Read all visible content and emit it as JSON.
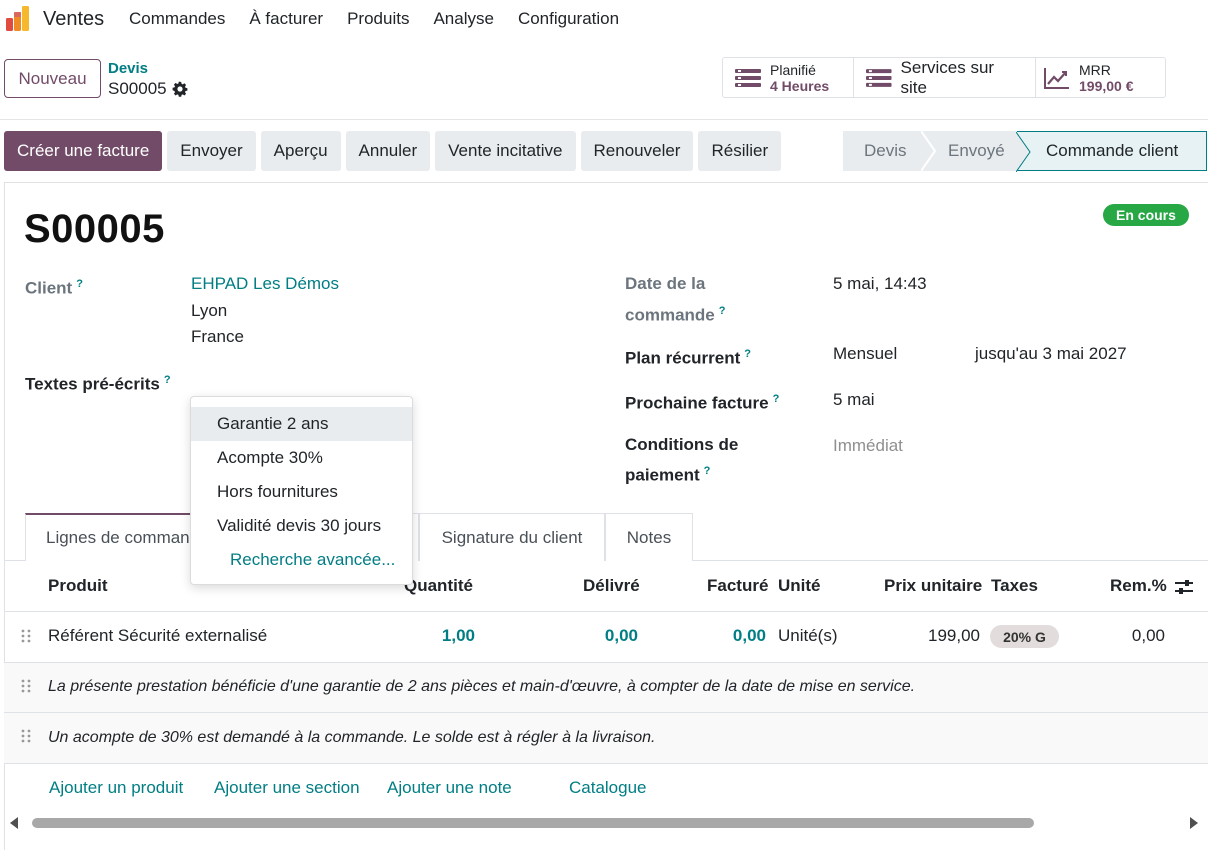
{
  "navbar": {
    "app_name": "Ventes",
    "menu": [
      "Commandes",
      "À facturer",
      "Produits",
      "Analyse",
      "Configuration"
    ]
  },
  "control": {
    "new_label": "Nouveau",
    "breadcrumb_parent": "Devis",
    "breadcrumb_current": "S00005"
  },
  "smart_buttons": {
    "planned_title": "Planifié",
    "planned_value": "4 Heures",
    "onsite_label": "Services sur site",
    "mrr_title": "MRR",
    "mrr_value": "199,00 €"
  },
  "actions": [
    "Créer une facture",
    "Envoyer",
    "Aperçu",
    "Annuler",
    "Vente incitative",
    "Renouveler",
    "Résilier"
  ],
  "statusbar": [
    "Devis",
    "Envoyé",
    "Commande client"
  ],
  "record": {
    "title": "S00005",
    "status_badge": "En cours",
    "client_label": "Client",
    "client_name": "EHPAD Les Démos",
    "client_city": "Lyon",
    "client_country": "France",
    "templates_label": "Textes pré-écrits",
    "order_date_label_1": "Date de la",
    "order_date_label_2": "commande",
    "order_date_value": "5 mai, 14:43",
    "plan_label": "Plan récurrent",
    "plan_value": "Mensuel",
    "plan_until": "jusqu'au 3 mai 2027",
    "next_invoice_label": "Prochaine facture",
    "next_invoice_value": "5 mai",
    "payment_terms_label_1": "Conditions de",
    "payment_terms_label_2": "paiement",
    "payment_terms_placeholder": "Immédiat"
  },
  "dropdown": {
    "items": [
      "Garantie 2 ans",
      "Acompte 30%",
      "Hors fournitures",
      "Validité devis 30 jours"
    ],
    "advanced": "Recherche avancée..."
  },
  "tabs": [
    "Lignes de comman",
    "Signature du client",
    "Notes"
  ],
  "table": {
    "headers": {
      "product": "Produit",
      "quantity": "Quantité",
      "delivered": "Délivré",
      "invoiced": "Facturé",
      "unit": "Unité",
      "unit_price": "Prix unitaire",
      "taxes": "Taxes",
      "discount": "Rem.%"
    },
    "line": {
      "product": "Référent Sécurité externalisé",
      "quantity": "1,00",
      "delivered": "0,00",
      "invoiced": "0,00",
      "unit": "Unité(s)",
      "unit_price": "199,00",
      "tax": "20% G",
      "discount": "0,00"
    },
    "notes": [
      "La présente prestation bénéficie d'une garantie de 2 ans pièces et main-d'œuvre, à compter de la date de mise en service.",
      "Un acompte de 30% est demandé à la commande. Le solde est à régler à la livraison."
    ],
    "add_links": [
      "Ajouter un produit",
      "Ajouter une section",
      "Ajouter une note",
      "Catalogue"
    ]
  },
  "colors": {
    "brand": "#714b67",
    "link": "#017e84",
    "success": "#28a745"
  }
}
